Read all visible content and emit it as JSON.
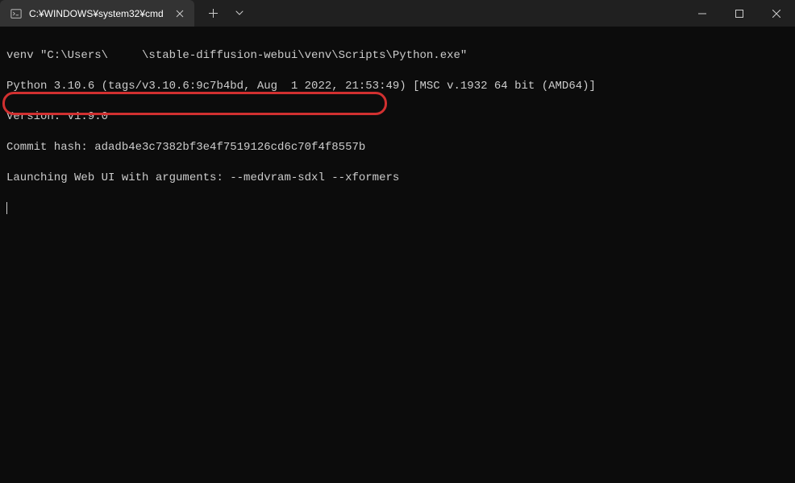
{
  "titlebar": {
    "tab_title": "C:¥WINDOWS¥system32¥cmd"
  },
  "terminal": {
    "lines": [
      "venv \"C:\\Users\\     \\stable-diffusion-webui\\venv\\Scripts\\Python.exe\"",
      "Python 3.10.6 (tags/v3.10.6:9c7b4bd, Aug  1 2022, 21:53:49) [MSC v.1932 64 bit (AMD64)]",
      "Version: v1.9.0",
      "Commit hash: adadb4e3c7382bf3e4f7519126cd6c70f4f8557b",
      "Launching Web UI with arguments: --medvram-sdxl --xformers"
    ]
  }
}
